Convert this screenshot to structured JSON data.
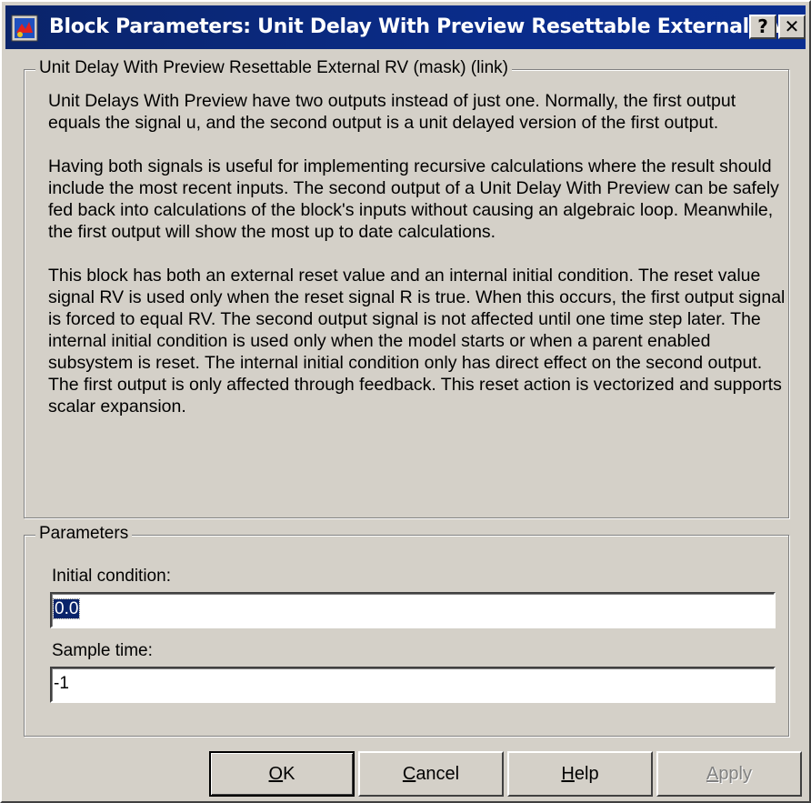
{
  "window": {
    "title": "Block Parameters: Unit Delay With Preview Resettable External RV",
    "help_button": "?",
    "close_button": "✕"
  },
  "description": {
    "group_title": "Unit Delay With Preview Resettable External RV (mask) (link)",
    "paragraphs": [
      "Unit Delays With Preview have two outputs instead of just one.  Normally, the first output equals the signal u, and the second output is a unit delayed version of the first output.",
      "Having both signals is useful for implementing recursive calculations where the result should include the most recent inputs.  The second output of a Unit Delay With Preview can be safely fed back into calculations of the block's inputs without causing an algebraic loop.  Meanwhile, the first output will show the most up to date calculations.",
      "This block has both an external reset value and an internal initial condition.  The reset value signal RV is used only when the reset signal R is true.  When this occurs, the first output signal is forced to equal RV.  The second output signal is not affected until one time step later.  The internal initial condition is used only when the model starts or when a parent enabled subsystem is reset.  The internal initial condition only has direct effect on the second output.  The first output is only affected through feedback.  This reset action is vectorized and supports scalar expansion."
    ]
  },
  "parameters": {
    "group_title": "Parameters",
    "initial_condition_label": "Initial condition:",
    "initial_condition_value": "0.0",
    "sample_time_label": "Sample time:",
    "sample_time_value": "-1"
  },
  "buttons": {
    "ok_mnemonic": "O",
    "ok_rest": "K",
    "cancel_mnemonic": "C",
    "cancel_rest": "ancel",
    "help_mnemonic": "H",
    "help_rest": "elp",
    "apply_mnemonic": "A",
    "apply_rest": "pply"
  }
}
